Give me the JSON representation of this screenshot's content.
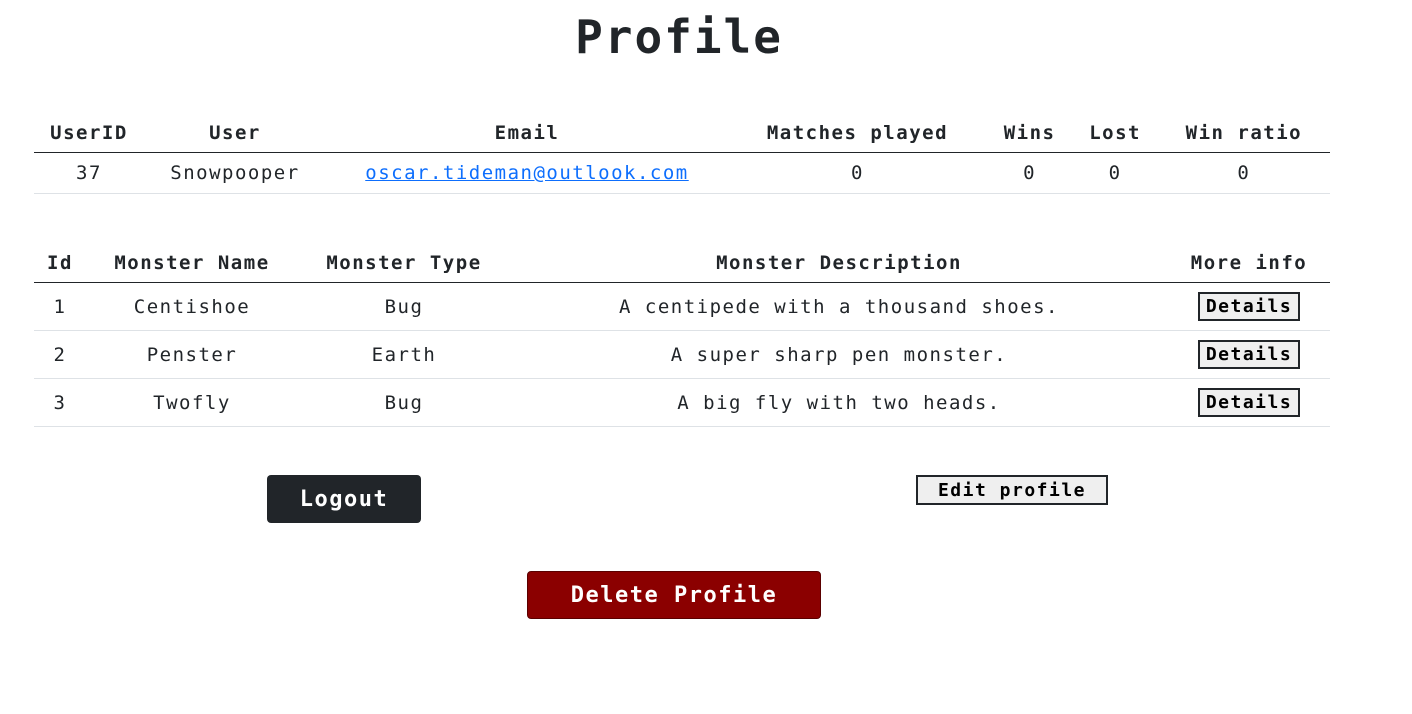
{
  "page": {
    "title": "Profile"
  },
  "user_table": {
    "headers": [
      "UserID",
      "User",
      "Email",
      "Matches played",
      "Wins",
      "Lost",
      "Win ratio"
    ],
    "row": {
      "user_id": "37",
      "user": "Snowpooper",
      "email": "oscar.tideman@outlook.com",
      "matches_played": "0",
      "wins": "0",
      "lost": "0",
      "win_ratio": "0"
    }
  },
  "monster_table": {
    "headers": [
      "Id",
      "Monster Name",
      "Monster Type",
      "Monster Description",
      "More info"
    ],
    "rows": [
      {
        "id": "1",
        "name": "Centishoe",
        "type": "Bug",
        "description": "A centipede with a thousand shoes.",
        "button": "Details"
      },
      {
        "id": "2",
        "name": "Penster",
        "type": "Earth",
        "description": "A super sharp pen monster.",
        "button": "Details"
      },
      {
        "id": "3",
        "name": "Twofly",
        "type": "Bug",
        "description": "A big fly with two heads.",
        "button": "Details"
      }
    ]
  },
  "actions": {
    "logout": "Logout",
    "edit_profile": "Edit profile",
    "delete_profile": "Delete Profile"
  },
  "colors": {
    "text": "#212529",
    "link": "#0d6efd",
    "logout_bg": "#212529",
    "delete_bg": "#8b0000"
  }
}
